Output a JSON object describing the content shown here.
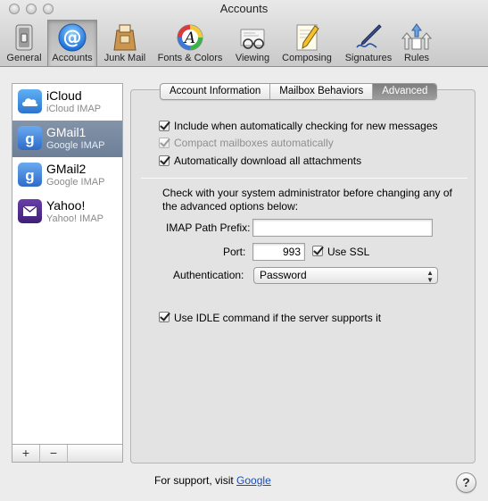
{
  "window": {
    "title": "Accounts"
  },
  "toolbar": {
    "items": [
      {
        "label": "General",
        "icon": "general-switch-icon"
      },
      {
        "label": "Accounts",
        "icon": "at-sign-icon",
        "selected": true
      },
      {
        "label": "Junk Mail",
        "icon": "junk-mail-bag-icon"
      },
      {
        "label": "Fonts & Colors",
        "icon": "fonts-colors-icon"
      },
      {
        "label": "Viewing",
        "icon": "viewing-glasses-icon"
      },
      {
        "label": "Composing",
        "icon": "composing-pencil-icon"
      },
      {
        "label": "Signatures",
        "icon": "signature-pen-icon"
      },
      {
        "label": "Rules",
        "icon": "rules-arrows-icon"
      }
    ]
  },
  "accounts": [
    {
      "name": "iCloud",
      "type": "iCloud IMAP",
      "icon": "icloud-icon"
    },
    {
      "name": "GMail1",
      "type": "Google IMAP",
      "icon": "google-icon",
      "selected": true
    },
    {
      "name": "GMail2",
      "type": "Google IMAP",
      "icon": "google-icon"
    },
    {
      "name": "Yahoo!",
      "type": "Yahoo! IMAP",
      "icon": "yahoo-envelope-icon"
    }
  ],
  "sidebar_buttons": {
    "add": "+",
    "remove": "−"
  },
  "tabs": [
    {
      "label": "Account Information"
    },
    {
      "label": "Mailbox Behaviors"
    },
    {
      "label": "Advanced",
      "active": true
    }
  ],
  "options": {
    "include_auto_check": {
      "label": "Include when automatically checking for new messages",
      "checked": true
    },
    "compact_mailboxes": {
      "label": "Compact mailboxes automatically",
      "checked": true,
      "disabled": true
    },
    "auto_download": {
      "label": "Automatically download all attachments",
      "checked": true
    },
    "use_idle": {
      "label": "Use IDLE command if the server supports it",
      "checked": true
    }
  },
  "advanced": {
    "note": "Check with your system administrator before changing any of the advanced options below:",
    "imap_prefix_label": "IMAP Path Prefix:",
    "imap_prefix_value": "",
    "port_label": "Port:",
    "port_value": "993",
    "ssl_label": "Use SSL",
    "ssl_checked": true,
    "auth_label": "Authentication:",
    "auth_value": "Password"
  },
  "footer": {
    "text": "For support, visit",
    "link": "Google"
  },
  "help_label": "?"
}
